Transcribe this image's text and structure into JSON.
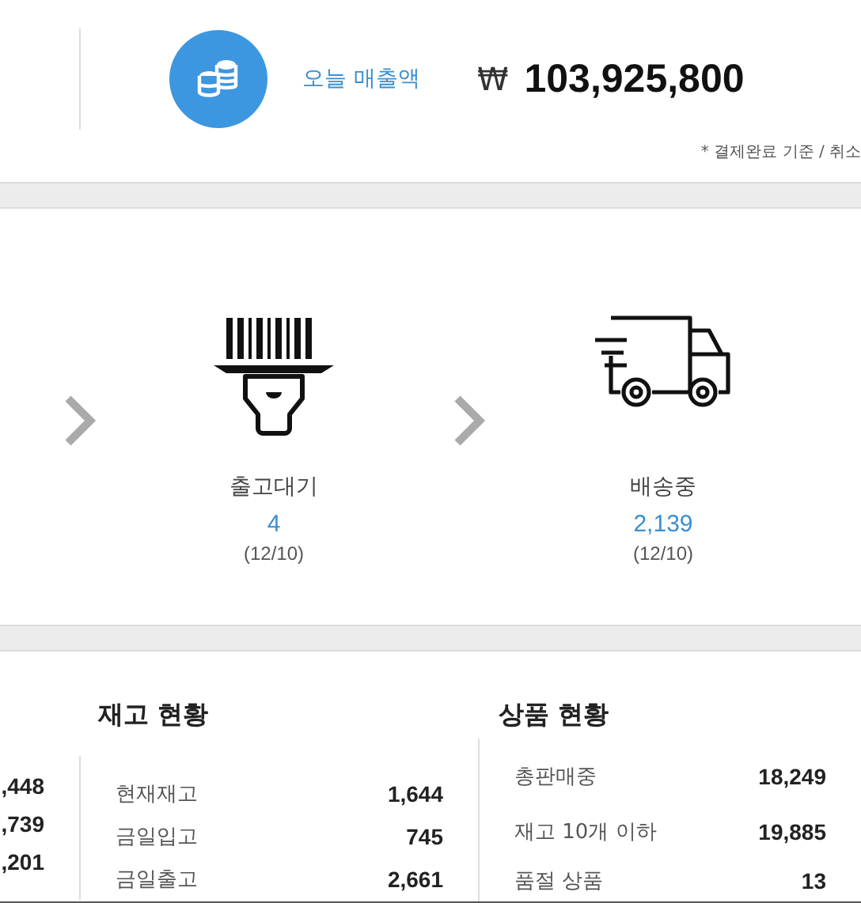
{
  "sales": {
    "label": "오늘 매출액",
    "currency": "₩",
    "amount": "103,925,800",
    "note": "* 결제완료 기준 / 취소"
  },
  "stages": [
    {
      "kind": "scanner",
      "label": "출고대기",
      "count": "4",
      "date": "(12/10)"
    },
    {
      "kind": "truck",
      "label": "배송중",
      "count": "2,139",
      "date": "(12/10)"
    }
  ],
  "partial_column": {
    "values": [
      ",448",
      ",739",
      ",201"
    ]
  },
  "inventory": {
    "title": "재고 현황",
    "rows": [
      {
        "label": "현재재고",
        "value": "1,644"
      },
      {
        "label": "금일입고",
        "value": "745"
      },
      {
        "label": "금일출고",
        "value": "2,661"
      }
    ]
  },
  "products": {
    "title": "상품 현황",
    "rows": [
      {
        "label": "총판매중",
        "value": "18,249"
      },
      {
        "label": "재고 10개 이하",
        "value": "19,885"
      },
      {
        "label": "품절 상품",
        "value": "13"
      }
    ]
  }
}
